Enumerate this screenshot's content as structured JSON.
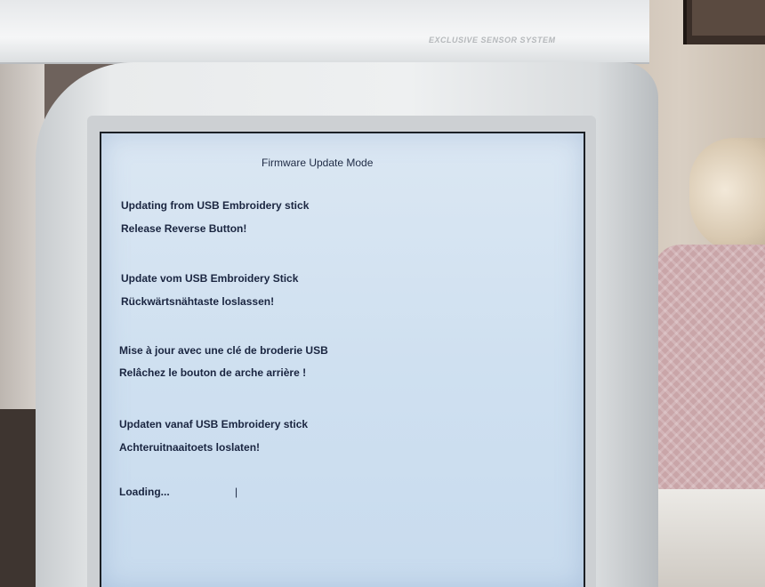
{
  "machine": {
    "brand_label": "EXCLUSIVE SENSOR SYSTEM"
  },
  "screen": {
    "title": "Firmware Update Mode",
    "messages": {
      "en": {
        "line1": "Updating from USB Embroidery stick",
        "line2": "Release Reverse Button!"
      },
      "de": {
        "line1": "Update vom USB Embroidery Stick",
        "line2": "Rückwärtsnähtaste loslassen!"
      },
      "fr": {
        "line1": "Mise à jour avec une clé de broderie USB",
        "line2": "Relâchez le bouton de arche arrière !"
      },
      "nl": {
        "line1": "Updaten vanaf USB Embroidery stick",
        "line2": "Achteruitnaaitoets loslaten!"
      }
    },
    "status": "Loading...",
    "progress_marker": "|"
  },
  "colors": {
    "screen_bg": "#d3e3f2",
    "text": "#1a2540",
    "bezel": "#e9ebec"
  }
}
